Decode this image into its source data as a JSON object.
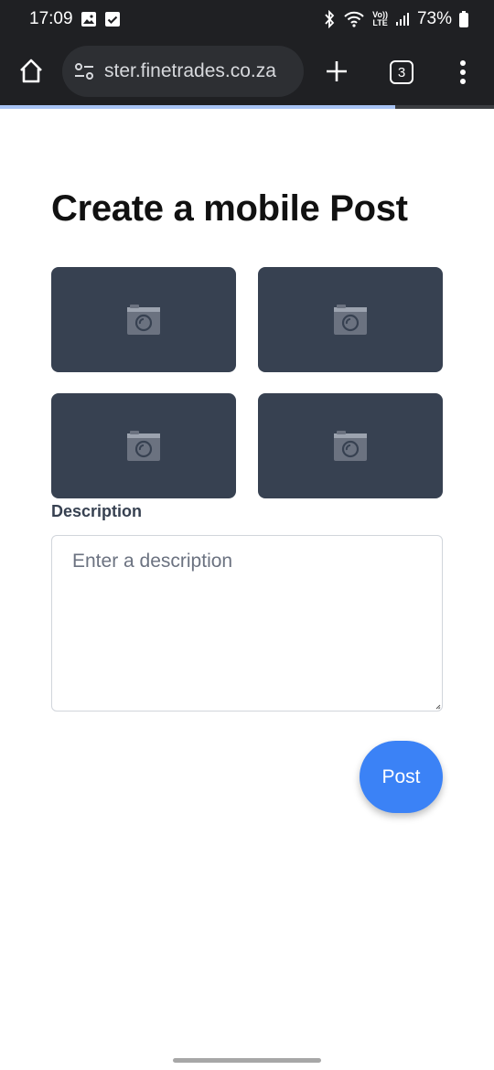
{
  "status_bar": {
    "time": "17:09",
    "network_label_top": "Vo))",
    "network_label_bottom": "LTE",
    "battery_percent": "73%"
  },
  "browser": {
    "url": "ster.finetrades.co.za",
    "tab_count": "3",
    "page_load_progress": 0.8
  },
  "page": {
    "title": "Create a mobile Post",
    "photo_slots": [
      {
        "icon": "camera-icon"
      },
      {
        "icon": "camera-icon"
      },
      {
        "icon": "camera-icon"
      },
      {
        "icon": "camera-icon"
      }
    ],
    "description_label": "Description",
    "description_placeholder": "Enter a description",
    "description_value": "",
    "post_button_label": "Post"
  },
  "colors": {
    "accent": "#3b82f6",
    "photo_slot_bg": "#374151",
    "browser_chrome": "#1f2023"
  }
}
